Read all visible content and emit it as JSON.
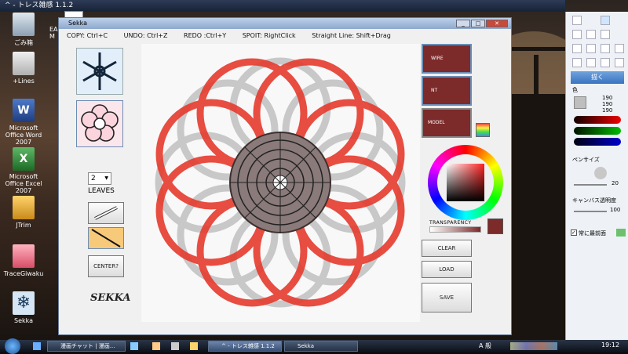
{
  "taskbar_title_top": "^ - トレス雑感 1.1.2",
  "desktop_icons": [
    {
      "label": "ごみ箱"
    },
    {
      "label": "+Lines"
    },
    {
      "label": "Microsoft Office Word 2007"
    },
    {
      "label": "Microsoft Office Excel 2007"
    },
    {
      "label": "JTrim"
    },
    {
      "label": "TraceGiwaku"
    },
    {
      "label": "Sekka"
    }
  ],
  "desktop_partial_text": "EA\nM",
  "sekka": {
    "title": "Sekka",
    "shortcuts": [
      "COPY: Ctrl+C",
      "UNDO: Ctrl+Z",
      "REDO :Ctrl+Y",
      "SPOIT: RightClick",
      "Straight Line: Shift+Drag"
    ],
    "leaves_value": "2",
    "leaves_label": "LEAVES",
    "center_label": "CENTER?",
    "logo_text": "SEKKA",
    "presets": [
      {
        "label": "WIRE"
      },
      {
        "label": "NT"
      },
      {
        "label": "MODEL"
      }
    ],
    "transparency_label": "TRANSPARENCY",
    "clear_label": "CLEAR",
    "load_label": "LOAD",
    "save_label": "SAVE",
    "accent_color": "#7c2a2a",
    "stroke_colors": [
      "#e63b2e",
      "#b8b8b8",
      "#3c3030"
    ]
  },
  "side_panel": {
    "draw_button": "描く",
    "color_label": "色",
    "rgb": [
      "190",
      "190",
      "190"
    ],
    "pen_size_label": "ペンサイズ",
    "pen_size_value": "20",
    "canvas_opacity_label": "キャンバス透明度",
    "canvas_opacity_value": "100",
    "always_front_label": "常に最前面",
    "always_front_checked": true
  },
  "taskbar": {
    "tasks": [
      "漫画チャット | 漫画...",
      "^ - トレス雑感 1.1.2",
      "Sekka"
    ],
    "tray_ime": "A 般",
    "clock": "19:12"
  }
}
